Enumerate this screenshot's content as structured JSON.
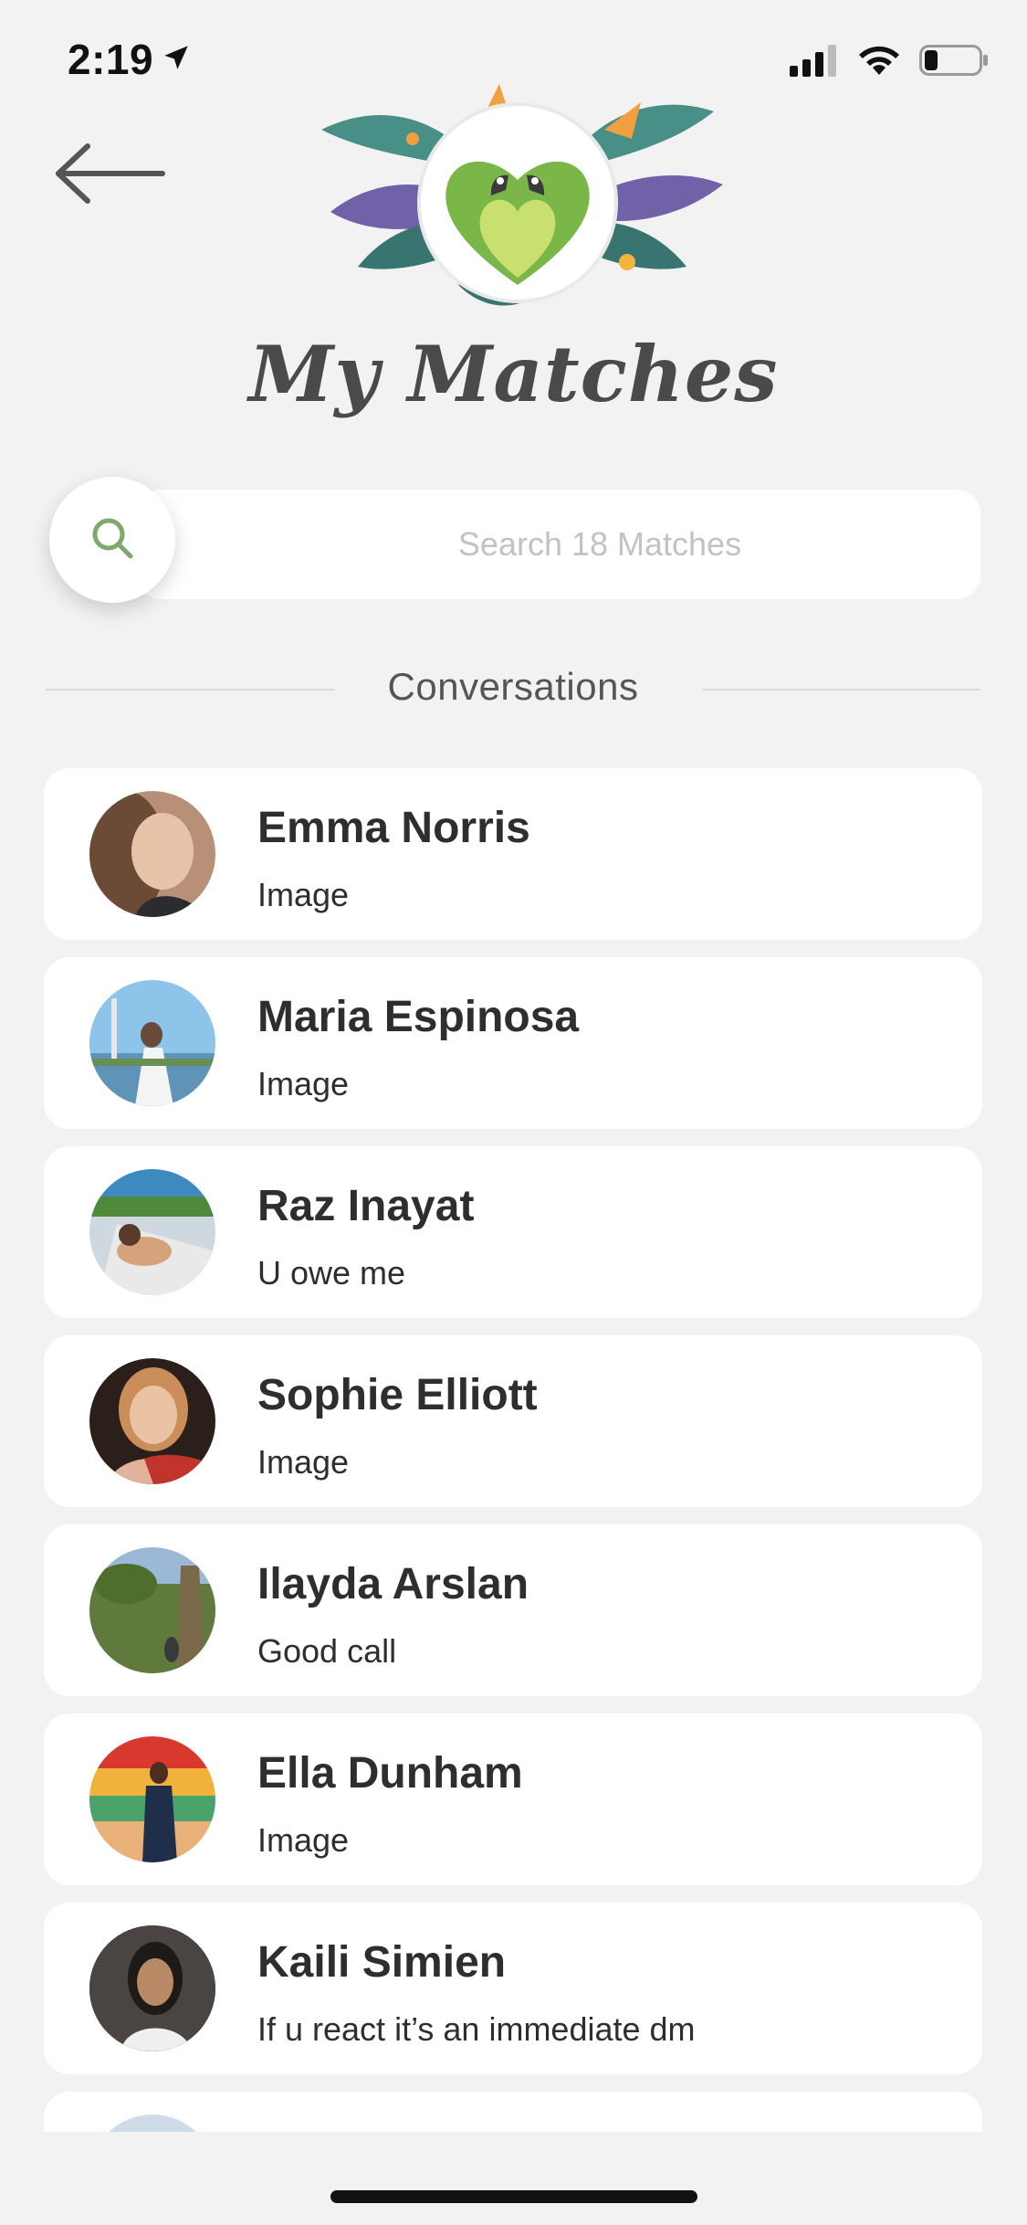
{
  "status_bar": {
    "time": "2:19",
    "location_icon": "location-arrow-icon",
    "signal_icon": "cellular-signal-icon",
    "wifi_icon": "wifi-icon",
    "battery_icon": "battery-low-icon"
  },
  "header": {
    "back_icon": "arrow-left-icon",
    "logo_icon": "parrot-heart-logo",
    "title": "My Matches"
  },
  "search": {
    "icon": "search-icon",
    "placeholder": "Search 18 Matches"
  },
  "section": {
    "title": "Conversations"
  },
  "conversations": [
    {
      "name": "Emma Norris",
      "preview": "Image"
    },
    {
      "name": "Maria Espinosa",
      "preview": "Image"
    },
    {
      "name": "Raz Inayat",
      "preview": "U owe me"
    },
    {
      "name": "Sophie Elliott",
      "preview": "Image"
    },
    {
      "name": "Ilayda Arslan",
      "preview": "Good call"
    },
    {
      "name": "Ella Dunham",
      "preview": "Image"
    },
    {
      "name": "Kaili Simien",
      "preview": "If u react it’s an immediate dm"
    },
    {
      "name": "",
      "preview": ""
    }
  ],
  "colors": {
    "background": "#f2f2f2",
    "card": "#ffffff",
    "accent_green": "#7ab648",
    "text_dark": "#2e2e2e"
  }
}
